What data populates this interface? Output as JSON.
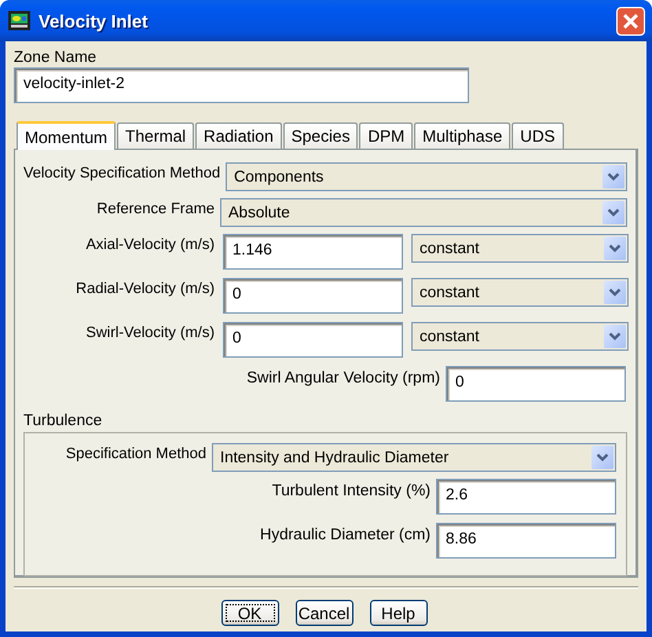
{
  "window": {
    "title": "Velocity Inlet"
  },
  "zone_name": {
    "label": "Zone Name",
    "value": "velocity-inlet-2"
  },
  "tabs": [
    {
      "label": "Momentum",
      "selected": true
    },
    {
      "label": "Thermal",
      "selected": false
    },
    {
      "label": "Radiation",
      "selected": false
    },
    {
      "label": "Species",
      "selected": false
    },
    {
      "label": "DPM",
      "selected": false
    },
    {
      "label": "Multiphase",
      "selected": false
    },
    {
      "label": "UDS",
      "selected": false
    }
  ],
  "momentum": {
    "rows": [
      {
        "kind": "dropdown",
        "label": "Velocity Specification Method",
        "value": "Components"
      },
      {
        "kind": "dropdown",
        "label": "Reference Frame",
        "value": "Absolute"
      },
      {
        "kind": "profile",
        "label": "Axial-Velocity (m/s)",
        "value": "1.146",
        "profile": "constant"
      },
      {
        "kind": "profile",
        "label": "Radial-Velocity (m/s)",
        "value": "0",
        "profile": "constant"
      },
      {
        "kind": "profile",
        "label": "Swirl-Velocity (m/s)",
        "value": "0",
        "profile": "constant"
      },
      {
        "kind": "field",
        "label": "Swirl Angular Velocity (rpm)",
        "value": "0"
      }
    ]
  },
  "turbulence": {
    "title": "Turbulence",
    "rows": [
      {
        "kind": "dropdown",
        "label": "Specification Method",
        "value": "Intensity and Hydraulic Diameter"
      },
      {
        "kind": "field",
        "label": "Turbulent Intensity (%)",
        "value": "2.6"
      },
      {
        "kind": "field",
        "label": "Hydraulic Diameter (cm)",
        "value": "8.86"
      }
    ]
  },
  "buttons": [
    {
      "label": "OK",
      "focused": true
    },
    {
      "label": "Cancel",
      "focused": false
    },
    {
      "label": "Help",
      "focused": false
    }
  ]
}
